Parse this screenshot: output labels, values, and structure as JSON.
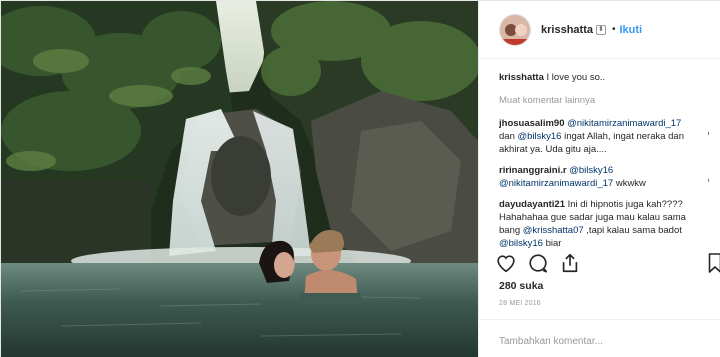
{
  "header": {
    "username": "krisshatta",
    "verified_symbol": "⬍",
    "separator": "•",
    "follow_label": "Ikuti"
  },
  "caption": {
    "username": "krisshatta",
    "text": "I love you so.."
  },
  "more_comments_label": "Muat komentar lainnya",
  "comments": [
    {
      "username": "jhosuasalim90",
      "mention": "@nikitamirzanimawardi_17",
      "text_mid": " dan ",
      "mention2": "@bilsky16",
      "text_end": " ingat Allah, ingat neraka dan akhirat ya. Uda gitu aja...."
    },
    {
      "username": "ririnanggraini.r",
      "mention": "@bilsky16",
      "text_mid": " ",
      "mention2": "@nikitamirzanimawardi_17",
      "text_end": " wkwkw"
    },
    {
      "username": "dayudayanti21",
      "text_start": " Ini di hipnotis juga kah???? Hahahahaa gue sadar juga mau kalau sama bang ",
      "mention": "@krisshatta07",
      "text_mid": " ,tapi kalau sama badot ",
      "mention2": "@bilsky16",
      "text_end": " biar"
    }
  ],
  "likes": "280 suka",
  "date": "28 MEI 2016",
  "add_comment": {
    "placeholder": "Tambahkan komentar..."
  },
  "icons": {
    "like": "heart-icon",
    "comment": "comment-icon",
    "share": "share-icon",
    "save": "bookmark-icon"
  },
  "colors": {
    "link": "#3897f0",
    "mention": "#003569",
    "muted": "#999999"
  }
}
